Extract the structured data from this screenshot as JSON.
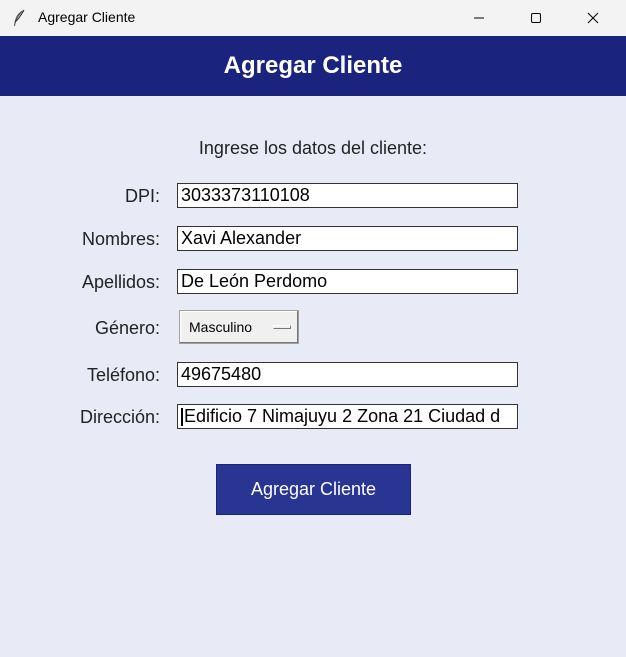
{
  "window": {
    "title": "Agregar Cliente",
    "app_icon": "feather-icon"
  },
  "header": {
    "title": "Agregar Cliente"
  },
  "form": {
    "intro": "Ingrese los datos del cliente:",
    "fields": {
      "dpi": {
        "label": "DPI:",
        "value": "3033373110108"
      },
      "nombres": {
        "label": "Nombres:",
        "value": "Xavi Alexander"
      },
      "apellidos": {
        "label": "Apellidos:",
        "value": "De León Perdomo"
      },
      "genero": {
        "label": "Género:",
        "value": "Masculino"
      },
      "telefono": {
        "label": "Teléfono:",
        "value": "49675480"
      },
      "direccion": {
        "label": "Dirección:",
        "value": "Edificio 7 Nimajuyu 2 Zona 21 Ciudad d"
      }
    },
    "submit_label": "Agregar Cliente"
  },
  "colors": {
    "header_bg": "#1a237e",
    "button_bg": "#283593",
    "window_bg": "#e8eaf6"
  }
}
